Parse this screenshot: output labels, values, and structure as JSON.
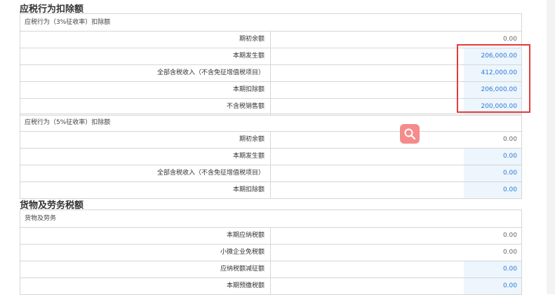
{
  "sections": {
    "deduction": {
      "title": "应税行为扣除额",
      "group3": {
        "header": "应税行为（3%征收率）扣除额",
        "rows": [
          {
            "label": "期初余额",
            "value": "0.00"
          },
          {
            "label": "本期发生额",
            "value": "206,000.00"
          },
          {
            "label": "全部含税收入（不含免征增值税项目）",
            "value": "412,000.00"
          },
          {
            "label": "本期扣除额",
            "value": "206,000.00"
          },
          {
            "label": "不含税销售额",
            "value": "200,000.00"
          }
        ]
      },
      "group5": {
        "header": "应税行为（5%征收率）扣除额",
        "rows": [
          {
            "label": "期初余额",
            "value": "0.00"
          },
          {
            "label": "本期发生额",
            "value": "0.00"
          },
          {
            "label": "全部含税收入（不含免征增值税项目）",
            "value": "0.00"
          },
          {
            "label": "本期扣除额",
            "value": "0.00"
          }
        ]
      }
    },
    "goods": {
      "title": "货物及劳务税额",
      "group": {
        "header": "货物及劳务",
        "rows": [
          {
            "label": "本期应纳税额",
            "value": "0.00"
          },
          {
            "label": "小微企业免税额",
            "value": "0.00"
          },
          {
            "label": "应纳税额减征额",
            "value": "0.00"
          },
          {
            "label": "本期预缴税额",
            "value": "0.00"
          }
        ]
      }
    }
  },
  "icons": {
    "search": "search-icon"
  },
  "colors": {
    "highlight": "#e23b3b",
    "editable_bg": "#edf5fd",
    "editable_text": "#2f7bd4",
    "fab": "#f58b8b"
  }
}
